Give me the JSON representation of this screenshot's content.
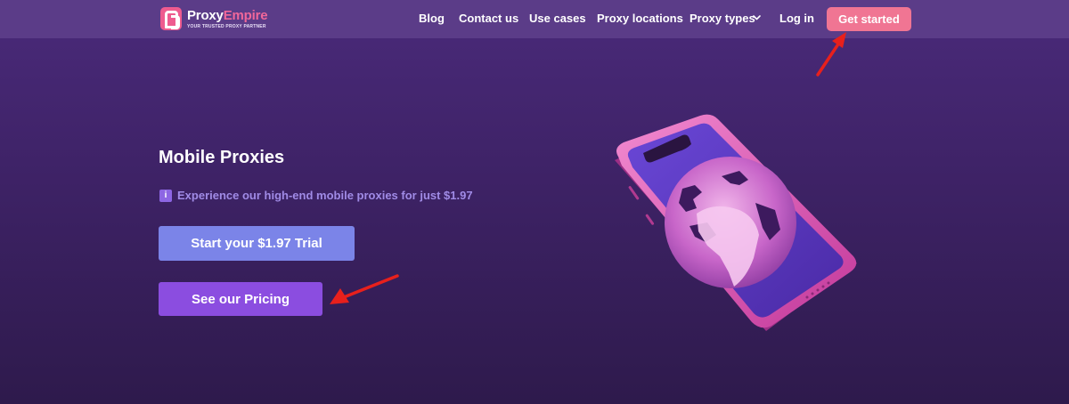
{
  "brand": {
    "name_part1": "Proxy",
    "name_part2": "Empire",
    "tagline": "YOUR TRUSTED PROXY PARTNER",
    "logo_icon": "proxyempire-logo-icon"
  },
  "nav": {
    "links": [
      "Blog",
      "Contact us",
      "Use cases",
      "Proxy locations",
      "Proxy types",
      "Log in"
    ],
    "dropdown_icon": "chevron-down-icon",
    "cta_label": "Get started"
  },
  "hero": {
    "title": "Mobile Proxies",
    "info_icon": "info-icon",
    "info_glyph": "i",
    "subtitle": "Experience our high-end mobile proxies for just $1.97",
    "trial_button": "Start your $1.97 Trial",
    "pricing_button": "See our Pricing",
    "illustration": "smartphone-globe-illustration"
  },
  "annotations": {
    "arrow_icon": "red-arrow-icon",
    "arrow_color": "#e8201c"
  },
  "colors": {
    "navbar": "#5b3c88",
    "background": "#3f2368",
    "cta": "#f07593",
    "trial_button": "#7b84e8",
    "pricing_button": "#8b4de0",
    "brand_accent": "#f0679a"
  }
}
